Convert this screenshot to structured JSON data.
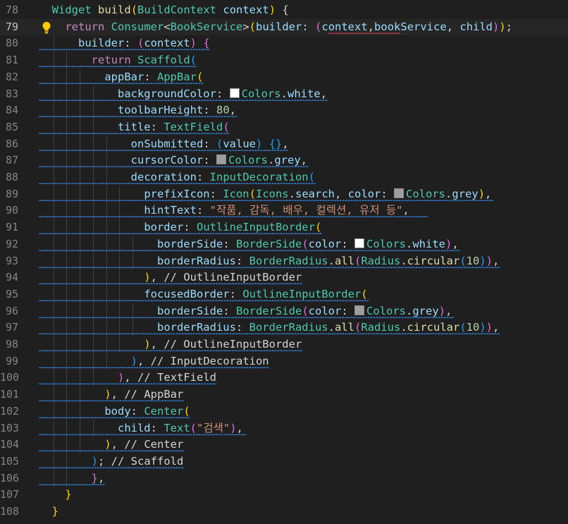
{
  "editor": {
    "current_line": 79,
    "colors": {
      "background": "#1f1f1f",
      "line_number": "#858585",
      "keyword": "#c586c0",
      "type": "#4ec9b0",
      "function": "#dcdcaa",
      "variable": "#9cdcfe",
      "string": "#ce9178",
      "number": "#b5cea8",
      "squiggle_info": "#3794ff",
      "squiggle_error": "#f14c4c"
    },
    "lightbulb_icon": "lightbulb-icon",
    "lines": [
      {
        "n": "78",
        "indent": 0,
        "tokens": [
          [
            "  ",
            "pu"
          ],
          [
            "Widget",
            "ty"
          ],
          [
            " ",
            "pu"
          ],
          [
            "build",
            "fn"
          ],
          [
            "(",
            "b1"
          ],
          [
            "BuildContext",
            "ty"
          ],
          [
            " ",
            "pu"
          ],
          [
            "context",
            "va"
          ],
          [
            ")",
            "b1"
          ],
          [
            " {",
            "pu"
          ]
        ]
      },
      {
        "n": "79",
        "indent": 1,
        "bulb": true,
        "tokens": [
          [
            "    ",
            "pu"
          ],
          [
            "return",
            "kw"
          ],
          [
            " ",
            "pu"
          ],
          [
            "Consumer",
            "ty"
          ],
          [
            "<",
            "pu"
          ],
          [
            "BookService",
            "ty"
          ],
          [
            ">",
            "pu"
          ],
          [
            "(",
            "b1"
          ],
          [
            "builder",
            "va"
          ],
          [
            ": ",
            "pu"
          ],
          [
            "(",
            "b2"
          ],
          [
            "context",
            "va"
          ],
          [
            ",",
            "pu"
          ],
          [
            "bookService",
            "va"
          ],
          [
            ", ",
            "pu"
          ],
          [
            "child",
            "va"
          ],
          [
            ")",
            "b2"
          ],
          [
            ")",
            "b1"
          ],
          [
            ";",
            "pu"
          ]
        ]
      },
      {
        "n": "80",
        "indent": 2,
        "tokens": [
          [
            "      ",
            "pu"
          ],
          [
            "builder",
            "va"
          ],
          [
            ": ",
            "pu"
          ],
          [
            "(",
            "b2"
          ],
          [
            "context",
            "va"
          ],
          [
            ")",
            "b2"
          ],
          [
            " {",
            "b2"
          ]
        ]
      },
      {
        "n": "81",
        "indent": 3,
        "tokens": [
          [
            "        ",
            "pu"
          ],
          [
            "return",
            "kw"
          ],
          [
            " ",
            "pu"
          ],
          [
            "Scaffold",
            "ty"
          ],
          [
            "(",
            "b3"
          ]
        ]
      },
      {
        "n": "82",
        "indent": 4,
        "tokens": [
          [
            "          ",
            "pu"
          ],
          [
            "appBar",
            "va"
          ],
          [
            ": ",
            "pu"
          ],
          [
            "AppBar",
            "ty"
          ],
          [
            "(",
            "b1"
          ]
        ]
      },
      {
        "n": "83",
        "indent": 5,
        "tokens": [
          [
            "            ",
            "pu"
          ],
          [
            "backgroundColor",
            "va"
          ],
          [
            ": ",
            "pu"
          ],
          [
            "#SW:#ffffff",
            "sw"
          ],
          [
            "Colors",
            "ty"
          ],
          [
            ".",
            "pu"
          ],
          [
            "white",
            "va"
          ],
          [
            ",",
            "pu"
          ]
        ]
      },
      {
        "n": "84",
        "indent": 5,
        "tokens": [
          [
            "            ",
            "pu"
          ],
          [
            "toolbarHeight",
            "va"
          ],
          [
            ": ",
            "pu"
          ],
          [
            "80",
            "nu"
          ],
          [
            ",",
            "pu"
          ]
        ]
      },
      {
        "n": "85",
        "indent": 5,
        "tokens": [
          [
            "            ",
            "pu"
          ],
          [
            "title",
            "va"
          ],
          [
            ": ",
            "pu"
          ],
          [
            "TextField",
            "ty"
          ],
          [
            "(",
            "b2"
          ]
        ]
      },
      {
        "n": "86",
        "indent": 6,
        "tokens": [
          [
            "              ",
            "pu"
          ],
          [
            "onSubmitted",
            "va"
          ],
          [
            ": ",
            "pu"
          ],
          [
            "(",
            "b3"
          ],
          [
            "value",
            "va"
          ],
          [
            ")",
            "b3"
          ],
          [
            " ",
            "pu"
          ],
          [
            "{}",
            "b3"
          ],
          [
            ",",
            "pu"
          ]
        ]
      },
      {
        "n": "87",
        "indent": 6,
        "tokens": [
          [
            "              ",
            "pu"
          ],
          [
            "cursorColor",
            "va"
          ],
          [
            ": ",
            "pu"
          ],
          [
            "#SW:#9e9e9e",
            "sw"
          ],
          [
            "Colors",
            "ty"
          ],
          [
            ".",
            "pu"
          ],
          [
            "grey",
            "va"
          ],
          [
            ",",
            "pu"
          ]
        ]
      },
      {
        "n": "88",
        "indent": 6,
        "tokens": [
          [
            "              ",
            "pu"
          ],
          [
            "decoration",
            "va"
          ],
          [
            ": ",
            "pu"
          ],
          [
            "InputDecoration",
            "ty"
          ],
          [
            "(",
            "b3"
          ]
        ]
      },
      {
        "n": "89",
        "indent": 7,
        "tokens": [
          [
            "                ",
            "pu"
          ],
          [
            "prefixIcon",
            "va"
          ],
          [
            ": ",
            "pu"
          ],
          [
            "Icon",
            "ty"
          ],
          [
            "(",
            "b1"
          ],
          [
            "Icons",
            "ty"
          ],
          [
            ".",
            "pu"
          ],
          [
            "search",
            "va"
          ],
          [
            ", ",
            "pu"
          ],
          [
            "color",
            "va"
          ],
          [
            ": ",
            "pu"
          ],
          [
            "#SW:#9e9e9e",
            "sw"
          ],
          [
            "Colors",
            "ty"
          ],
          [
            ".",
            "pu"
          ],
          [
            "grey",
            "va"
          ],
          [
            ")",
            "b1"
          ],
          [
            ",",
            "pu"
          ]
        ]
      },
      {
        "n": "90",
        "indent": 7,
        "tokens": [
          [
            "                ",
            "pu"
          ],
          [
            "hintText",
            "va"
          ],
          [
            ": ",
            "pu"
          ],
          [
            "\"작품, 감독, 배우, 컬렉션, 유저 등\"",
            "st"
          ],
          [
            ",",
            "pu"
          ]
        ]
      },
      {
        "n": "91",
        "indent": 7,
        "tokens": [
          [
            "                ",
            "pu"
          ],
          [
            "border",
            "va"
          ],
          [
            ": ",
            "pu"
          ],
          [
            "OutlineInputBorder",
            "ty"
          ],
          [
            "(",
            "b1"
          ]
        ]
      },
      {
        "n": "92",
        "indent": 8,
        "tokens": [
          [
            "                  ",
            "pu"
          ],
          [
            "borderSide",
            "va"
          ],
          [
            ": ",
            "pu"
          ],
          [
            "BorderSide",
            "ty"
          ],
          [
            "(",
            "b2"
          ],
          [
            "color",
            "va"
          ],
          [
            ": ",
            "pu"
          ],
          [
            "#SW:#ffffff",
            "sw"
          ],
          [
            "Colors",
            "ty"
          ],
          [
            ".",
            "pu"
          ],
          [
            "white",
            "va"
          ],
          [
            ")",
            "b2"
          ],
          [
            ",",
            "pu"
          ]
        ]
      },
      {
        "n": "93",
        "indent": 8,
        "tokens": [
          [
            "                  ",
            "pu"
          ],
          [
            "borderRadius",
            "va"
          ],
          [
            ": ",
            "pu"
          ],
          [
            "BorderRadius",
            "ty"
          ],
          [
            ".",
            "pu"
          ],
          [
            "all",
            "fn"
          ],
          [
            "(",
            "b2"
          ],
          [
            "Radius",
            "ty"
          ],
          [
            ".",
            "pu"
          ],
          [
            "circular",
            "fn"
          ],
          [
            "(",
            "b3"
          ],
          [
            "10",
            "nu"
          ],
          [
            ")",
            "b3"
          ],
          [
            ")",
            "b2"
          ],
          [
            ",",
            "pu"
          ]
        ]
      },
      {
        "n": "94",
        "indent": 7,
        "tokens": [
          [
            "                ",
            "pu"
          ],
          [
            ")",
            "b1"
          ],
          [
            ", ",
            "pu"
          ],
          [
            "// OutlineInputBorder",
            "cm"
          ]
        ]
      },
      {
        "n": "95",
        "indent": 7,
        "tokens": [
          [
            "                ",
            "pu"
          ],
          [
            "focusedBorder",
            "va"
          ],
          [
            ": ",
            "pu"
          ],
          [
            "OutlineInputBorder",
            "ty"
          ],
          [
            "(",
            "b1"
          ]
        ]
      },
      {
        "n": "96",
        "indent": 8,
        "tokens": [
          [
            "                  ",
            "pu"
          ],
          [
            "borderSide",
            "va"
          ],
          [
            ": ",
            "pu"
          ],
          [
            "BorderSide",
            "ty"
          ],
          [
            "(",
            "b2"
          ],
          [
            "color",
            "va"
          ],
          [
            ": ",
            "pu"
          ],
          [
            "#SW:#9e9e9e",
            "sw"
          ],
          [
            "Colors",
            "ty"
          ],
          [
            ".",
            "pu"
          ],
          [
            "grey",
            "va"
          ],
          [
            ")",
            "b2"
          ],
          [
            ",",
            "pu"
          ]
        ]
      },
      {
        "n": "97",
        "indent": 8,
        "tokens": [
          [
            "                  ",
            "pu"
          ],
          [
            "borderRadius",
            "va"
          ],
          [
            ": ",
            "pu"
          ],
          [
            "BorderRadius",
            "ty"
          ],
          [
            ".",
            "pu"
          ],
          [
            "all",
            "fn"
          ],
          [
            "(",
            "b2"
          ],
          [
            "Radius",
            "ty"
          ],
          [
            ".",
            "pu"
          ],
          [
            "circular",
            "fn"
          ],
          [
            "(",
            "b3"
          ],
          [
            "10",
            "nu"
          ],
          [
            ")",
            "b3"
          ],
          [
            ")",
            "b2"
          ],
          [
            ",",
            "pu"
          ]
        ]
      },
      {
        "n": "98",
        "indent": 7,
        "tokens": [
          [
            "                ",
            "pu"
          ],
          [
            ")",
            "b1"
          ],
          [
            ", ",
            "pu"
          ],
          [
            "// OutlineInputBorder",
            "cm"
          ]
        ]
      },
      {
        "n": "99",
        "indent": 6,
        "tokens": [
          [
            "              ",
            "pu"
          ],
          [
            ")",
            "b3"
          ],
          [
            ", ",
            "pu"
          ],
          [
            "// InputDecoration",
            "cm"
          ]
        ]
      },
      {
        "n": "100",
        "indent": 5,
        "tokens": [
          [
            "            ",
            "pu"
          ],
          [
            ")",
            "b2"
          ],
          [
            ", ",
            "pu"
          ],
          [
            "// TextField",
            "cm"
          ]
        ]
      },
      {
        "n": "101",
        "indent": 4,
        "tokens": [
          [
            "          ",
            "pu"
          ],
          [
            ")",
            "b1"
          ],
          [
            ", ",
            "pu"
          ],
          [
            "// AppBar",
            "cm"
          ]
        ]
      },
      {
        "n": "102",
        "indent": 4,
        "tokens": [
          [
            "          ",
            "pu"
          ],
          [
            "body",
            "va"
          ],
          [
            ": ",
            "pu"
          ],
          [
            "Center",
            "ty"
          ],
          [
            "(",
            "b1"
          ]
        ]
      },
      {
        "n": "103",
        "indent": 5,
        "tokens": [
          [
            "            ",
            "pu"
          ],
          [
            "child",
            "va"
          ],
          [
            ": ",
            "pu"
          ],
          [
            "Text",
            "ty"
          ],
          [
            "(",
            "b2"
          ],
          [
            "\"검색\"",
            "st"
          ],
          [
            ")",
            "b2"
          ],
          [
            ",",
            "pu"
          ]
        ]
      },
      {
        "n": "104",
        "indent": 4,
        "tokens": [
          [
            "          ",
            "pu"
          ],
          [
            ")",
            "b1"
          ],
          [
            ", ",
            "pu"
          ],
          [
            "// Center",
            "cm"
          ]
        ]
      },
      {
        "n": "105",
        "indent": 3,
        "tokens": [
          [
            "        ",
            "pu"
          ],
          [
            ")",
            "b3"
          ],
          [
            "; ",
            "pu"
          ],
          [
            "// Scaffold",
            "cm"
          ]
        ]
      },
      {
        "n": "106",
        "indent": 3,
        "tokens": [
          [
            "        ",
            "pu"
          ],
          [
            "}",
            "b2"
          ],
          [
            ",",
            "pu"
          ]
        ]
      },
      {
        "n": "107",
        "indent": 1,
        "tokens": [
          [
            "    ",
            "pu"
          ],
          [
            "}",
            "b1"
          ]
        ]
      },
      {
        "n": "108",
        "indent": 0,
        "tokens": [
          [
            "  ",
            "pu"
          ],
          [
            "}",
            "b1"
          ]
        ]
      }
    ]
  }
}
